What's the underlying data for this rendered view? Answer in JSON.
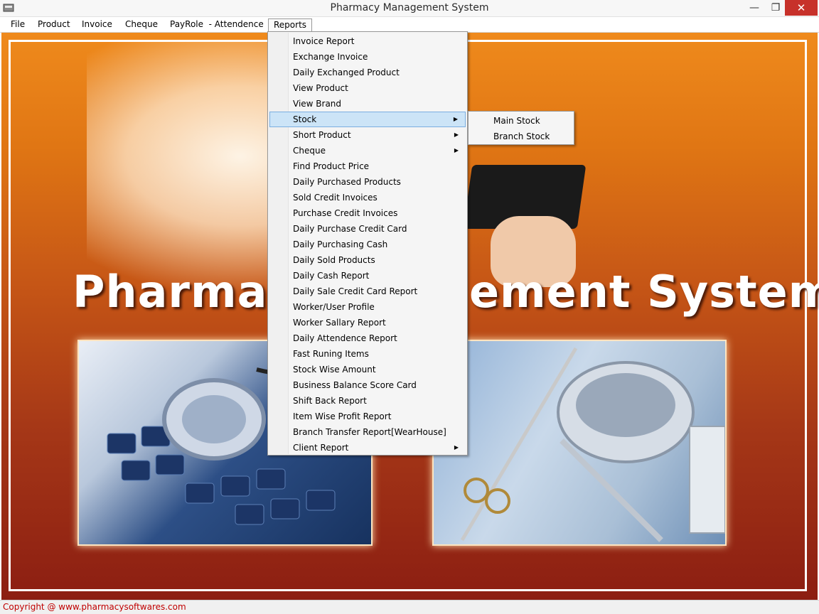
{
  "window": {
    "title": "Pharmacy Management System",
    "minimize_label": "—",
    "restore_label": "❐",
    "close_label": "✕"
  },
  "menubar": {
    "items": [
      "File",
      "Product",
      "Invoice",
      "Cheque",
      "PayRole  - Attendence",
      "Reports"
    ],
    "open": "Reports"
  },
  "reports_menu": {
    "items": [
      {
        "label": "Invoice Report"
      },
      {
        "label": "Exchange Invoice"
      },
      {
        "label": "Daily Exchanged Product"
      },
      {
        "label": "View Product"
      },
      {
        "label": "View Brand"
      },
      {
        "label": "Stock",
        "has_submenu": true,
        "highlighted": true
      },
      {
        "label": "Short Product",
        "has_submenu": true
      },
      {
        "label": "Cheque",
        "has_submenu": true
      },
      {
        "label": "Find Product Price"
      },
      {
        "label": "Daily Purchased Products"
      },
      {
        "label": "Sold Credit Invoices"
      },
      {
        "label": "Purchase Credit Invoices"
      },
      {
        "label": "Daily Purchase Credit Card"
      },
      {
        "label": "Daily Purchasing Cash"
      },
      {
        "label": "Daily Sold Products"
      },
      {
        "label": "Daily Cash Report"
      },
      {
        "label": "Daily Sale Credit Card Report"
      },
      {
        "label": "Worker/User Profile"
      },
      {
        "label": "Worker Sallary Report"
      },
      {
        "label": "Daily Attendence Report"
      },
      {
        "label": "Fast Runing Items"
      },
      {
        "label": "Stock Wise Amount"
      },
      {
        "label": "Business Balance Score Card"
      },
      {
        "label": "Shift Back Report"
      },
      {
        "label": "Item Wise Profit Report"
      },
      {
        "label": "Branch Transfer Report[WearHouse]"
      },
      {
        "label": "Client Report",
        "has_submenu": true
      }
    ]
  },
  "stock_submenu": {
    "items": [
      "Main Stock",
      "Branch Stock"
    ]
  },
  "background": {
    "banner_left": "Pharmacy",
    "banner_right": "ement System"
  },
  "statusbar": {
    "copyright": "Copyright @ www.pharmacysoftwares.com"
  },
  "colors": {
    "highlight": "#cce4f7",
    "close_button": "#c7312a",
    "copyright_text": "#c00000",
    "bg_top": "#ef8a1c",
    "bg_bottom": "#8c1e12"
  },
  "icons": {
    "app": "app-icon",
    "submenu_arrow": "chevron-right-icon"
  }
}
